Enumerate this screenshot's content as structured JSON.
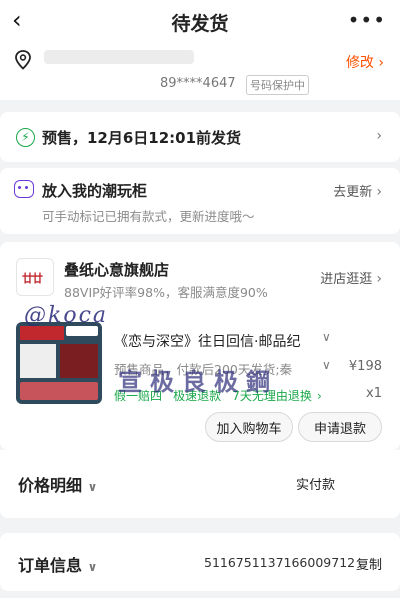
{
  "header": {
    "title": "待发货"
  },
  "address": {
    "modify": "修改",
    "phone": "89****4647",
    "privacy": "号码保护中"
  },
  "presale": {
    "text": "预售，12月6日12:01前发货"
  },
  "collection": {
    "title": "放入我的潮玩柜",
    "action": "去更新",
    "subtitle": "可手动标记已拥有款式，更新进度哦～"
  },
  "shop": {
    "name": "叠纸心意旗舰店",
    "stats": "88VIP好评率98%，客服满意度90%",
    "visit": "进店逛逛"
  },
  "product": {
    "title": "《恋与深空》往日回信·邮品纪",
    "spec": "预售商品，付款后200天发货;秦",
    "price": "¥198",
    "qty": "x1",
    "tags": [
      "假一赔四",
      "极速退款",
      "7天无理由退换"
    ]
  },
  "actions": {
    "cart": "加入购物车",
    "refund": "申请退款"
  },
  "price": {
    "title": "价格明细",
    "paid": "实付款"
  },
  "order": {
    "title": "订单信息",
    "number": "5116751137166009712",
    "copy": "复制"
  },
  "watermark": {
    "line1": "@koca",
    "line2": "宣极良极鋼"
  },
  "colors": {
    "green": "#1aa84a",
    "orange": "#ff5000",
    "purple": "#6a3bd6"
  }
}
